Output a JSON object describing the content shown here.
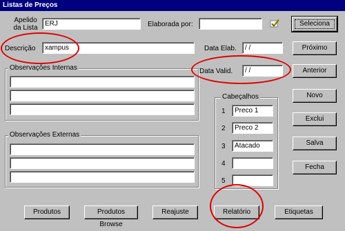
{
  "window": {
    "title": "Listas de Preços"
  },
  "form": {
    "apelido_label_1": "Apelido",
    "apelido_label_2": "da Lista",
    "apelido_value": "ERJ",
    "elaborada_label": "Elaborada por:",
    "elaborada_value": "",
    "descricao_label": "Descrição",
    "descricao_value": "xampus",
    "data_elab_label": "Data Elab.",
    "data_elab_value": " / /",
    "data_valid_label": "Data Valid.",
    "data_valid_value": " / /"
  },
  "obs_internas": {
    "title": "Observações Internas",
    "lines": [
      "",
      "",
      ""
    ]
  },
  "obs_externas": {
    "title": "Observações Externas",
    "lines": [
      "",
      "",
      ""
    ]
  },
  "cabecalhos": {
    "title": "Cabeçalhos",
    "rows": [
      {
        "num": "1",
        "value": "Preco 1"
      },
      {
        "num": "2",
        "value": "Preco 2"
      },
      {
        "num": "3",
        "value": "Atacado"
      },
      {
        "num": "4",
        "value": ""
      },
      {
        "num": "5",
        "value": ""
      }
    ]
  },
  "side_buttons": {
    "seleciona": "Seleciona",
    "proximo": "Próximo",
    "anterior": "Anterior",
    "novo": "Novo",
    "exclui": "Exclui",
    "salva": "Salva",
    "fecha": "Fecha"
  },
  "bottom_buttons": {
    "produtos": "Produtos",
    "produtos_browse": "Produtos Browse",
    "reajuste": "Reajuste",
    "relatorio": "Relatório",
    "etiquetas": "Etiquetas"
  },
  "colors": {
    "annotation_circle": "#e00000",
    "title_bar": "#000080"
  },
  "icons": {
    "pick_user": "checkmark-icon"
  }
}
